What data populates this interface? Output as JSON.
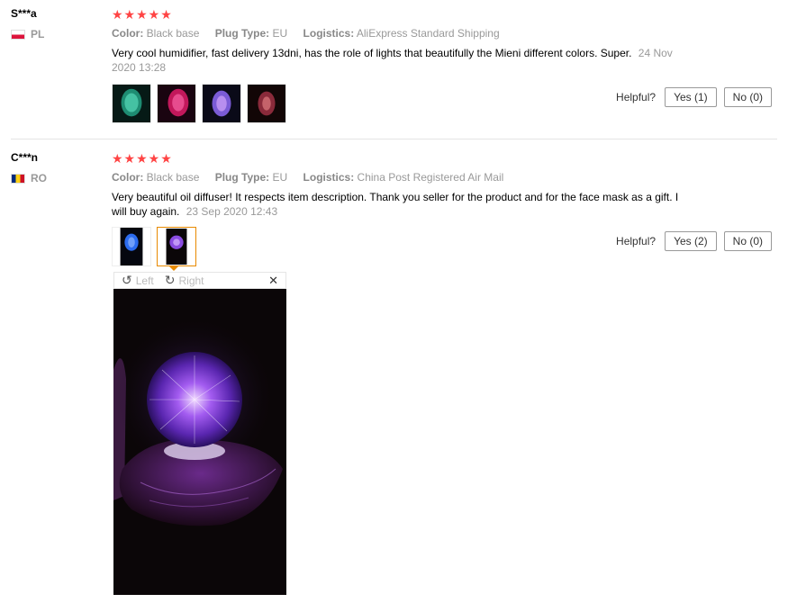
{
  "reviews": [
    {
      "user": "S***a",
      "country": "PL",
      "stars": "★★★★★",
      "color_label": "Color:",
      "color": "Black base",
      "plug_label": "Plug Type:",
      "plug": "EU",
      "logistics_label": "Logistics:",
      "logistics": "AliExpress Standard Shipping",
      "text": "Very cool humidifier, fast delivery 13dni, has the role of lights that beautifully the Mieni different colors. Super.",
      "date": "24 Nov 2020 13:28",
      "helpful_label": "Helpful?",
      "yes": "Yes (1)",
      "no": "No (0)"
    },
    {
      "user": "C***n",
      "country": "RO",
      "stars": "★★★★★",
      "color_label": "Color:",
      "color": "Black base",
      "plug_label": "Plug Type:",
      "plug": "EU",
      "logistics_label": "Logistics:",
      "logistics": "China Post Registered Air Mail",
      "text": "Very beautiful oil diffuser! It respects item description. Thank you seller for the product and for the face mask as a gift. I will buy again.",
      "date": "23 Sep 2020 12:43",
      "helpful_label": "Helpful?",
      "yes": "Yes (2)",
      "no": "No (0)"
    }
  ],
  "viewer": {
    "left": "Left",
    "right": "Right",
    "close": "✕"
  },
  "colors": {
    "stars": "#ff4444",
    "selected_border": "#e88a00"
  }
}
